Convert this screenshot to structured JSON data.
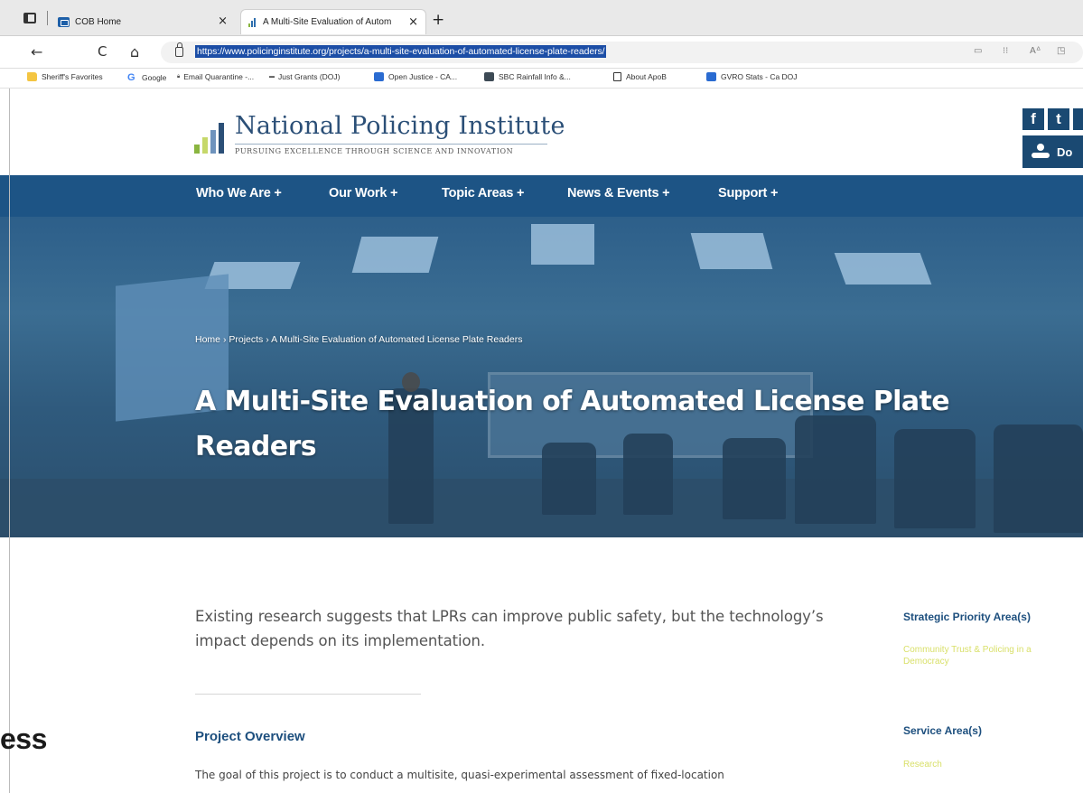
{
  "browser": {
    "tabs": [
      {
        "label": "COB Home",
        "close": "×"
      },
      {
        "label": "A Multi-Site Evaluation of Autom",
        "close": "×"
      }
    ],
    "new_tab": "+",
    "nav": {
      "back": "←",
      "reload": "C",
      "home": "⌂"
    },
    "url": "https://www.policinginstitute.org/projects/a-multi-site-evaluation-of-automated-license-plate-readers/",
    "right_icons": [
      "▭",
      "⁝⁝",
      "Aᐞ",
      "◳"
    ],
    "bookmarks": [
      {
        "label": "Sheriff's Favorites",
        "icon": "folder-icon"
      },
      {
        "label": "Google",
        "icon": "google-icon"
      },
      {
        "label": "Email Quarantine -...",
        "icon": "lock-icon"
      },
      {
        "label": "Just Grants (DOJ)",
        "icon": "doj-icon"
      },
      {
        "label": "Open Justice - CA...",
        "icon": "oj-icon"
      },
      {
        "label": "SBC Rainfall Info &...",
        "icon": "rain-icon"
      },
      {
        "label": "About ApoB",
        "icon": "page-icon"
      },
      {
        "label": "GVRO Stats - Ca DOJ",
        "icon": "oj-icon"
      }
    ]
  },
  "site": {
    "logo_title": "National Policing Institute",
    "logo_tagline": "Pursuing Excellence through Science and Innovation",
    "social": [
      "f",
      "t"
    ],
    "donate_label": "Do",
    "nav": [
      "Who We Are +",
      "Our Work +",
      "Topic Areas +",
      "News & Events +",
      "Support +"
    ],
    "breadcrumb": {
      "home": "Home",
      "sep": "›",
      "projects": "Projects",
      "current": "A Multi-Site Evaluation of Automated License Plate Readers"
    },
    "hero_title": "A Multi-Site Evaluation of Automated License Plate Readers",
    "intro": "Existing research suggests that LPRs can improve public safety, but the technology’s impact depends on its implementation.",
    "section_title": "Project Overview",
    "body_text": "The goal of this project is to conduct a multisite, quasi-experimental assessment of fixed-location",
    "sidebar": {
      "priority_title": "Strategic Priority Area(s)",
      "priority_link": "Community Trust & Policing in a Democracy",
      "service_title": "Service Area(s)",
      "service_link": "Research"
    }
  },
  "left_fragment": "ess",
  "colors": {
    "nav_blue": "#1d5485",
    "brand_blue": "#2b4f77",
    "link_yellow": "#d9e06a",
    "heading_blue": "#1d4f7e"
  }
}
